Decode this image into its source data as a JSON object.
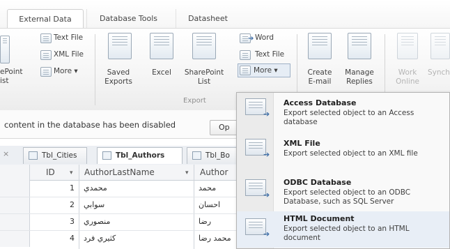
{
  "ribbon_tabs": [
    "External Data",
    "Database Tools",
    "Datasheet"
  ],
  "ribbon": {
    "import_partial": {
      "text_file": "Text File",
      "xml_file": "XML File",
      "sharepoint_list_line1": "ePoint",
      "sharepoint_list_line2": "ist",
      "more": "More ▾"
    },
    "export": {
      "saved_exports_line1": "Saved",
      "saved_exports_line2": "Exports",
      "excel": "Excel",
      "sharepoint_line1": "SharePoint",
      "sharepoint_line2": "List",
      "word": "Word",
      "text_file": "Text File",
      "more": "More ▾",
      "group_label": "Export"
    },
    "collect": {
      "create_email_line1": "Create",
      "create_email_line2": "E-mail",
      "manage_replies_line1": "Manage",
      "manage_replies_line2": "Replies"
    },
    "offline": {
      "work_online_line1": "Work",
      "work_online_line2": "Online",
      "sync_partial": "Synch"
    }
  },
  "security_bar": {
    "message": "content in the database has been disabled",
    "options_partial": "Op"
  },
  "doc_tabs": [
    "Tbl_Cities",
    "Tbl_Authors",
    "Tbl_Bo"
  ],
  "table": {
    "columns": [
      "ID",
      "AuthorLastName",
      "Author"
    ],
    "sort_glyph": "▾",
    "rows": [
      {
        "id": "1",
        "last": "محمدي",
        "first": "محمد"
      },
      {
        "id": "2",
        "last": "سوابي",
        "first": "احسان"
      },
      {
        "id": "3",
        "last": "منصوري",
        "first": "رضا"
      },
      {
        "id": "4",
        "last": "كثيري فرد",
        "first": "محمد رضا"
      }
    ]
  },
  "export_menu": [
    {
      "title": "Access Database",
      "description": "Export selected object to an Access database"
    },
    {
      "title": "XML File",
      "description": "Export selected object to an XML file"
    },
    {
      "title": "ODBC Database",
      "description": "Export selected object to an ODBC Database, such as SQL Server"
    },
    {
      "title": "HTML Document",
      "description": "Export selected object to an HTML document"
    }
  ],
  "colors": {
    "accent": "#3f6fa8",
    "menu_highlight": "#e8eef6",
    "ribbon_bg": "#f3f3f3"
  }
}
